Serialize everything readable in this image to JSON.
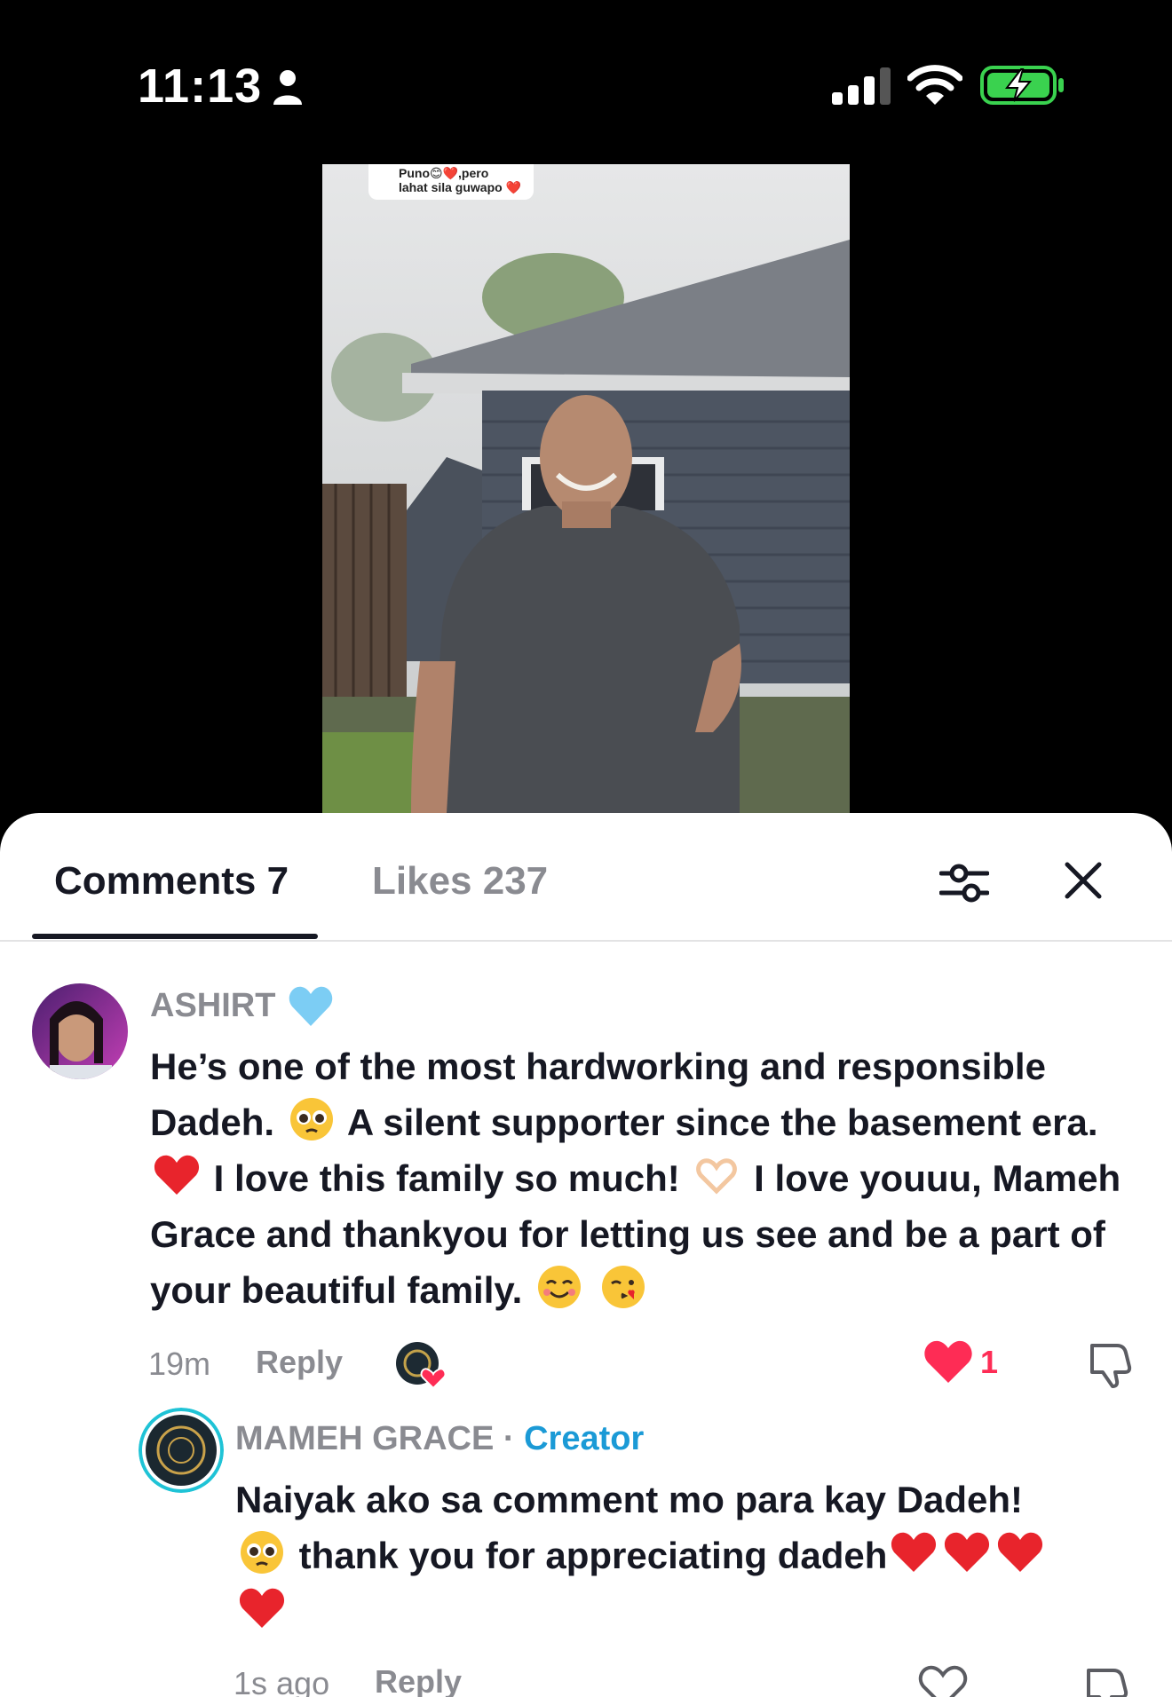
{
  "status_bar": {
    "time": "11:13"
  },
  "video": {
    "caption_line1": "Puno😊❤️,pero",
    "caption_line2": "lahat sila guwapo ❤️"
  },
  "tabs": {
    "comments_label": "Comments 7",
    "likes_label": "Likes 237"
  },
  "comments": [
    {
      "username": "ASHIRT",
      "text_parts": [
        "He’s one of the most hardworking and responsible Dadeh.",
        "A silent supporter since the basement era.",
        "I love this family so much!",
        "I love youuu, Mameh Grace and thankyou for letting us see and be a part of your beautiful family."
      ],
      "time_ago": "19m",
      "reply_label": "Reply",
      "like_count": "1"
    }
  ],
  "reply": {
    "username": "MAMEH GRACE",
    "separator": "·",
    "creator_label": "Creator",
    "text_part1": "Naiyak ako sa comment mo para kay Dadeh!",
    "text_part2": "thank you for appreciating dadeh",
    "time_ago": "1s ago",
    "reply_label": "Reply"
  },
  "colors": {
    "accent_like": "#fe2c55",
    "creator_blue": "#1b9ad6",
    "muted_text": "#8a8b91",
    "primary_text": "#161823"
  }
}
